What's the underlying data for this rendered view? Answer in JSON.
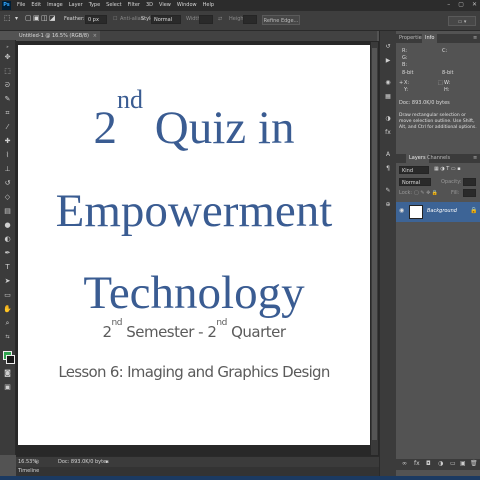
{
  "app": {
    "logo": "Ps"
  },
  "menu": [
    "File",
    "Edit",
    "Image",
    "Layer",
    "Type",
    "Select",
    "Filter",
    "3D",
    "View",
    "Window",
    "Help"
  ],
  "window_buttons": [
    "–",
    "▢",
    "✕"
  ],
  "options": {
    "feather_label": "Feather:",
    "feather_value": "0 px",
    "antialias_label": "Anti-alias",
    "style_label": "Style:",
    "style_value": "Normal",
    "width_label": "Width:",
    "height_label": "Height:",
    "refine_edge": "Refine Edge..."
  },
  "document": {
    "tab_title": "Untitled-1 @ 16.5% (RGB/8)",
    "title_part1": "2",
    "title_sup": "nd",
    "title_part2": " Quiz in",
    "title_line2": "Empowerment",
    "title_line3": "Technology",
    "semester": {
      "a": "2",
      "a_sup": "nd",
      "b": " Semester - 2",
      "b_sup": "nd",
      "c": " Quarter"
    },
    "lesson": "Lesson 6: Imaging and Graphics Design"
  },
  "status": {
    "zoom": "16.53%",
    "doc": "Doc: 893.0K/0 bytes"
  },
  "timeline_tab": "Timeline",
  "right_panel": {
    "tabs_top": [
      "Properties",
      "Info"
    ],
    "info_r": "R:",
    "info_g": "G:",
    "info_b": "B:",
    "info_bit": "8-bit",
    "info_x": "X:",
    "info_y": "Y:",
    "info_w": "W:",
    "info_h": "H:",
    "doc_size": "Doc: 893.0K/0 bytes",
    "description": "Draw rectangular selection or move selection outline. Use Shift, Alt, and Ctrl for additional options.",
    "tabs_layers": [
      "Layers",
      "Channels"
    ],
    "kind_label": "Kind",
    "blend_mode": "Normal",
    "opacity_label": "Opacity:",
    "lock_label": "Lock:",
    "fill_label": "Fill:",
    "layer_name": "Background"
  },
  "colors": {
    "foreground": "#2fa44f",
    "background": "#1a1a1a",
    "title_text": "#3a5c92",
    "layer_selected": "#3d6496"
  }
}
